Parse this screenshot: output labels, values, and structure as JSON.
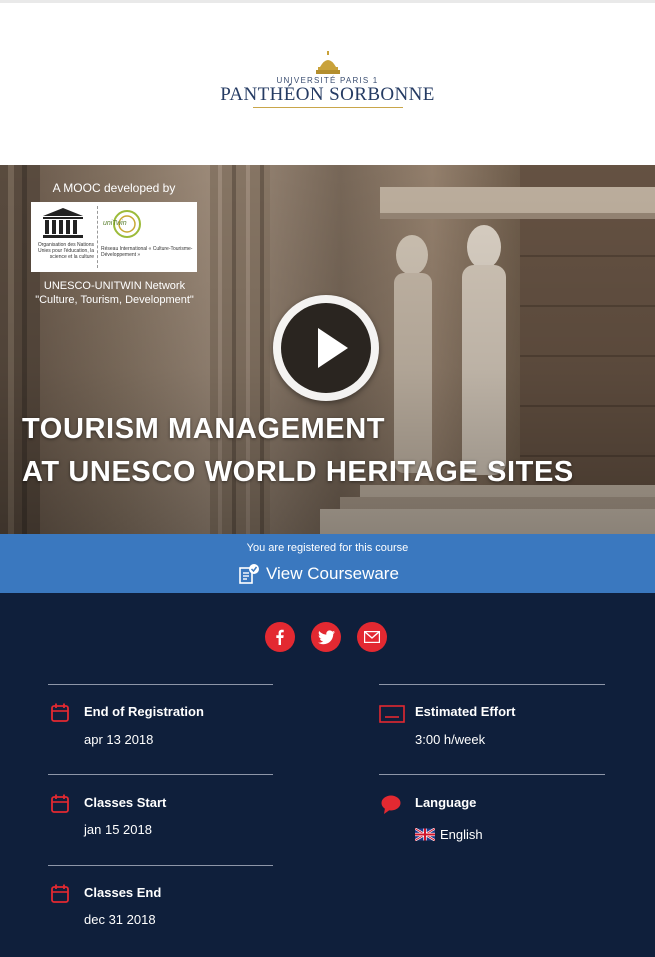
{
  "header": {
    "university_line1": "UNIVERSITÉ PARIS 1",
    "university_line2": "PANTHÉON SORBONNE"
  },
  "hero": {
    "developed_by": "A MOOC developed by",
    "unesco_logo_text": "UNESCO",
    "unesco_caption": "Organisation des Nations Unies pour l'éducation, la science et la culture",
    "unitwin_logo_text": "uniTwin",
    "unitwin_caption": "Réseau International « Culture-Tourisme-Développement »",
    "network_line1": "UNESCO-UNITWIN Network",
    "network_line2": "\"Culture, Tourism, Development\"",
    "title_line1": "TOURISM MANAGEMENT",
    "title_line2": "AT UNESCO WORLD HERITAGE SITES",
    "play_icon": "play-icon"
  },
  "registration": {
    "status": "You are registered for this course",
    "courseware_label": "View Courseware"
  },
  "share": {
    "icons": [
      "facebook-icon",
      "twitter-icon",
      "email-icon"
    ]
  },
  "details": {
    "end_registration": {
      "label": "End of Registration",
      "value": "apr 13 2018"
    },
    "classes_start": {
      "label": "Classes Start",
      "value": "jan 15 2018"
    },
    "classes_end": {
      "label": "Classes End",
      "value": "dec 31 2018"
    },
    "effort": {
      "label": "Estimated Effort",
      "value": "3:00 h/week"
    },
    "language": {
      "label": "Language",
      "value": "English"
    }
  },
  "colors": {
    "accent_red": "#e32931",
    "band_blue": "#3a78bf",
    "panel_navy": "#0f1f3b"
  }
}
